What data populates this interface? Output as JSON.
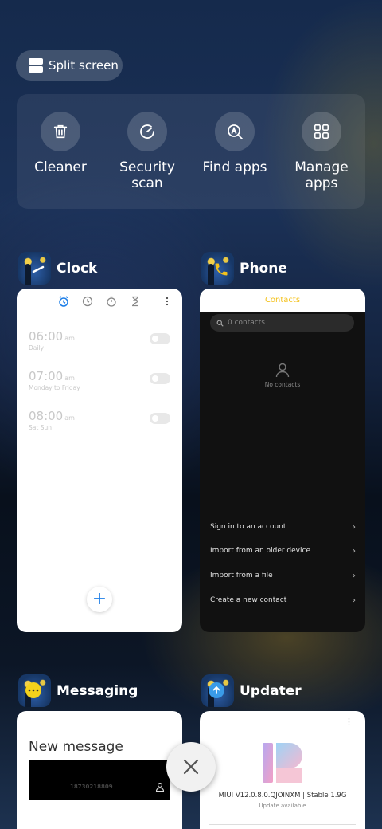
{
  "split_screen": {
    "label": "Split screen"
  },
  "tools": [
    {
      "label": "Cleaner",
      "icon": "trash-icon"
    },
    {
      "label": "Security scan",
      "icon": "gauge-icon"
    },
    {
      "label": "Find apps",
      "icon": "search-apps-icon"
    },
    {
      "label": "Manage apps",
      "icon": "grid-icon"
    }
  ],
  "apps": {
    "clock": {
      "name": "Clock",
      "accent": "#1e7fe8",
      "alarms": [
        {
          "time": "06:00",
          "ampm": "am",
          "repeat": "Daily"
        },
        {
          "time": "07:00",
          "ampm": "am",
          "repeat": "Monday to Friday"
        },
        {
          "time": "08:00",
          "ampm": "am",
          "repeat": "Sat Sun"
        }
      ],
      "fab": "+"
    },
    "phone": {
      "name": "Phone",
      "tab_title": "Contacts",
      "search_placeholder": "0 contacts",
      "empty_text": "No contacts",
      "options": [
        "Sign in to an account",
        "Import from an older device",
        "Import from a file",
        "Create a new contact"
      ],
      "accent": "#f4c21c"
    },
    "messaging": {
      "name": "Messaging",
      "title": "New message",
      "recipient": "18730218809"
    },
    "updater": {
      "name": "Updater",
      "version": "MIUI V12.0.8.0.QJOINXM | Stable 1.9G",
      "status": "Update available"
    }
  }
}
